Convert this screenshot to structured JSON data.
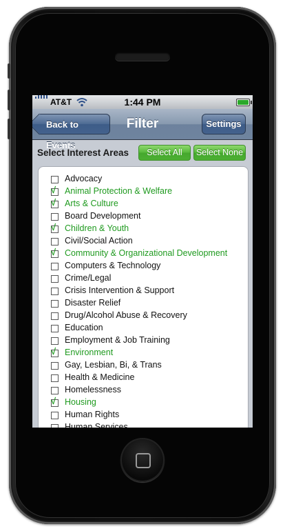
{
  "status": {
    "carrier": "AT&T",
    "time": "1:44 PM",
    "wifi_icon": "wifi-icon",
    "battery_icon": "battery-icon",
    "battery_color": "#2aa82a"
  },
  "nav": {
    "back_label": "Back to Events",
    "title": "Filter",
    "settings_label": "Settings"
  },
  "filter": {
    "heading": "Select Interest Areas",
    "select_all": "Select All",
    "select_none": "Select None",
    "check_glyph": "√",
    "checked_color": "#1f9a1f",
    "items": [
      {
        "label": "Advocacy",
        "checked": false
      },
      {
        "label": "Animal Protection & Welfare",
        "checked": true
      },
      {
        "label": "Arts & Culture",
        "checked": true
      },
      {
        "label": "Board Development",
        "checked": false
      },
      {
        "label": "Children & Youth",
        "checked": true
      },
      {
        "label": "Civil/Social Action",
        "checked": false
      },
      {
        "label": "Community & Organizational Development",
        "checked": true
      },
      {
        "label": "Computers & Technology",
        "checked": false
      },
      {
        "label": "Crime/Legal",
        "checked": false
      },
      {
        "label": "Crisis Intervention & Support",
        "checked": false
      },
      {
        "label": "Disaster Relief",
        "checked": false
      },
      {
        "label": "Drug/Alcohol Abuse & Recovery",
        "checked": false
      },
      {
        "label": "Education",
        "checked": false
      },
      {
        "label": "Employment & Job Training",
        "checked": false
      },
      {
        "label": "Environment",
        "checked": true
      },
      {
        "label": "Gay, Lesbian, Bi, & Trans",
        "checked": false
      },
      {
        "label": "Health & Medicine",
        "checked": false
      },
      {
        "label": "Homelessness",
        "checked": false
      },
      {
        "label": "Housing",
        "checked": true
      },
      {
        "label": "Human Rights",
        "checked": false
      },
      {
        "label": "Human Services",
        "checked": false
      }
    ]
  }
}
